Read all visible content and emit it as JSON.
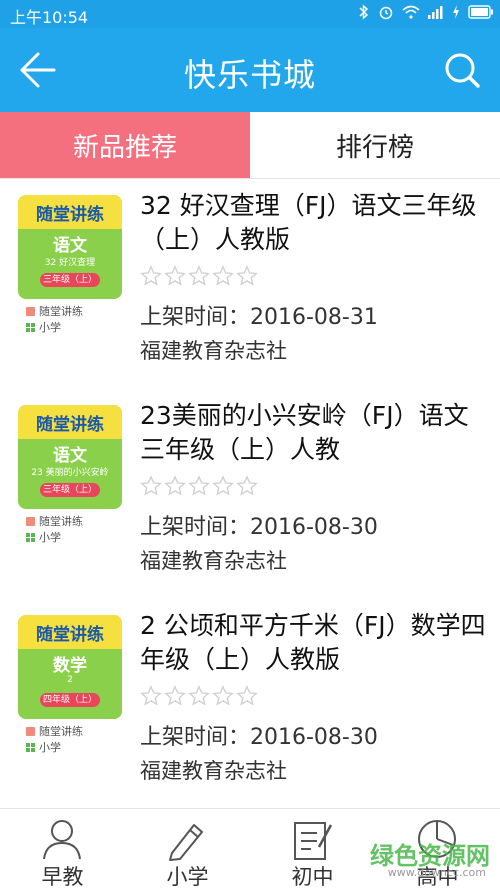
{
  "status_bar": {
    "time": "上午10:54"
  },
  "app_bar": {
    "title": "快乐书城",
    "back_icon": "arrow-left-icon",
    "search_icon": "search-icon"
  },
  "tabs": [
    {
      "label": "新品推荐",
      "active": true
    },
    {
      "label": "排行榜",
      "active": false
    }
  ],
  "books": [
    {
      "title": "32 好汉查理（FJ）语文三年级（上）人教版",
      "cover_series": "随堂讲练",
      "cover_subject": "语文",
      "cover_line": "32 好汉查理",
      "cover_grade": "三年级（上）",
      "series": "随堂讲练",
      "level": "小学",
      "rating": 0,
      "date": "上架时间：2016-08-31",
      "publisher": "福建教育杂志社"
    },
    {
      "title": "23美丽的小兴安岭（FJ）语文三年级（上）人教",
      "cover_series": "随堂讲练",
      "cover_subject": "语文",
      "cover_line": "23 美丽的小兴安岭",
      "cover_grade": "三年级（上）",
      "series": "随堂讲练",
      "level": "小学",
      "rating": 0,
      "date": "上架时间：2016-08-30",
      "publisher": "福建教育杂志社"
    },
    {
      "title": "2 公顷和平方千米（FJ）数学四年级（上）人教版",
      "cover_series": "随堂讲练",
      "cover_subject": "数学",
      "cover_line": "2",
      "cover_grade": "四年级（上）",
      "series": "随堂讲练",
      "level": "小学",
      "rating": 0,
      "date": "上架时间：2016-08-30",
      "publisher": "福建教育杂志社"
    }
  ],
  "bottom_nav": [
    {
      "label": "早教",
      "icon": "person-icon"
    },
    {
      "label": "小学",
      "icon": "pencil-icon"
    },
    {
      "label": "初中",
      "icon": "notebook-icon"
    },
    {
      "label": "高中",
      "icon": "chart-icon"
    }
  ],
  "watermark": {
    "text": "绿色资源网",
    "sub": "www.downcc.com"
  },
  "colors": {
    "primary": "#22a7ec",
    "tab_active": "#f5707f",
    "star": "#d8d8d8"
  }
}
